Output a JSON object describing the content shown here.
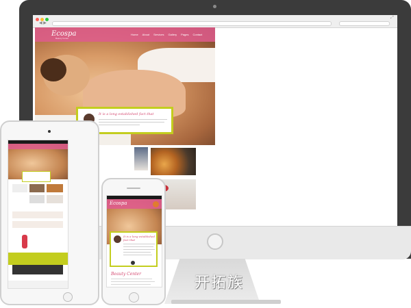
{
  "desktop": {
    "site": {
      "logo": "Ecospa",
      "logo_subtitle": "Beauty Center",
      "nav": [
        "Home",
        "About",
        "Services",
        "Gallery",
        "Pages",
        "Contact"
      ],
      "quote_title": "It is a long established fact that"
    }
  },
  "brand": {
    "label": "开拓族"
  },
  "iphone": {
    "logo": "Ecospa",
    "quote_title": "It is a long established fact that",
    "section_title": "Beauty Center"
  },
  "colors": {
    "accent_pink": "#df5c8d",
    "accent_lime": "#c3cd1e",
    "frame": "#3b3b3b"
  }
}
